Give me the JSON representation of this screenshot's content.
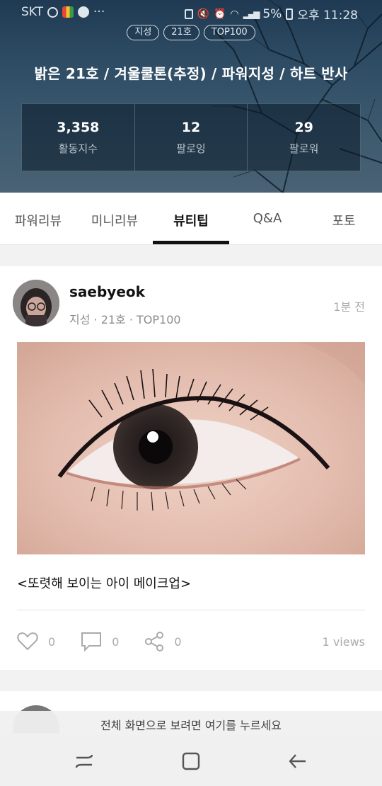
{
  "status_bar": {
    "carrier": "SKT",
    "battery": "5%",
    "time": "오후 11:28"
  },
  "profile": {
    "tags": [
      "지성",
      "21호",
      "TOP100"
    ],
    "title": "밝은 21호 / 겨울쿨톤(추정) / 파워지성 / 하트 반사",
    "stats": [
      {
        "value": "3,358",
        "label": "활동지수"
      },
      {
        "value": "12",
        "label": "팔로잉"
      },
      {
        "value": "29",
        "label": "팔로워"
      }
    ]
  },
  "tabs": [
    {
      "label": "파워리뷰"
    },
    {
      "label": "미니리뷰"
    },
    {
      "label": "뷰티팁",
      "active": true
    },
    {
      "label": "Q&A"
    },
    {
      "label": "포토"
    }
  ],
  "post": {
    "username": "saebyeok",
    "meta": "지성 · 21호 · TOP100",
    "time_ago": "1분 전",
    "title": "<또렷해 보이는 아이 메이크업>",
    "likes": "0",
    "comments": "0",
    "shares": "0",
    "views": "1 views"
  },
  "toast": "전체 화면으로 보려면 여기를 누르세요",
  "nav_icons": [
    "recent-apps-icon",
    "home-icon",
    "back-icon"
  ],
  "colors": {
    "hero_bg": "#2f4e66",
    "active_tab": "#111111",
    "muted": "#aaaaaa"
  }
}
